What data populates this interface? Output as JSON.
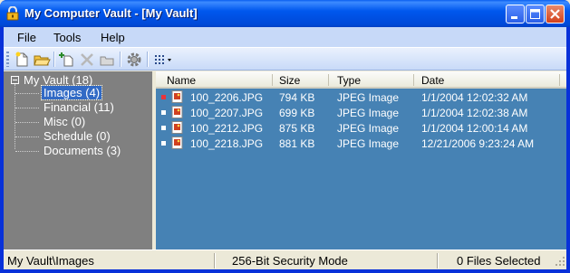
{
  "window": {
    "title": "My Computer Vault - [My Vault]",
    "app_icon": "padlock-icon",
    "controls": [
      "minimize-icon",
      "maximize-icon",
      "close-icon"
    ]
  },
  "menu": {
    "items": [
      {
        "label": "File"
      },
      {
        "label": "Tools"
      },
      {
        "label": "Help"
      }
    ]
  },
  "toolbar": {
    "buttons": [
      {
        "icon": "new-vault-icon"
      },
      {
        "icon": "open-vault-icon"
      },
      {
        "icon": "add-file-icon"
      },
      {
        "icon": "delete-icon"
      },
      {
        "icon": "extract-folder-icon"
      },
      {
        "icon": "settings-gear-icon"
      },
      {
        "icon": "view-options-icon"
      }
    ]
  },
  "tree": {
    "root": {
      "label": "My Vault (18)"
    },
    "items": [
      {
        "label": "Images (4)",
        "selected": true
      },
      {
        "label": "Financial (11)",
        "selected": false
      },
      {
        "label": "Misc (0)",
        "selected": false
      },
      {
        "label": "Schedule (0)",
        "selected": false
      },
      {
        "label": "Documents (3)",
        "selected": false
      }
    ]
  },
  "list": {
    "columns": [
      "Name",
      "Size",
      "Type",
      "Date"
    ],
    "rows": [
      {
        "name": "100_2206.JPG",
        "size": "794 KB",
        "type": "JPEG Image",
        "date": "1/1/2004 12:02:32 AM",
        "marker": "red"
      },
      {
        "name": "100_2207.JPG",
        "size": "699 KB",
        "type": "JPEG Image",
        "date": "1/1/2004 12:02:38 AM",
        "marker": "white"
      },
      {
        "name": "100_2212.JPG",
        "size": "875 KB",
        "type": "JPEG Image",
        "date": "1/1/2004 12:00:14 AM",
        "marker": "white"
      },
      {
        "name": "100_2218.JPG",
        "size": "881 KB",
        "type": "JPEG Image",
        "date": "12/21/2006 9:23:24 AM",
        "marker": "white"
      }
    ]
  },
  "status": {
    "path": "My Vault\\Images",
    "security": "256-Bit Security Mode",
    "selection": "0 Files Selected"
  },
  "colors": {
    "title_bar": "#0058ee",
    "tree_background": "#808080",
    "list_background": "#4682b4",
    "selection": "#316ac5",
    "marker_red": "#e8343b"
  }
}
